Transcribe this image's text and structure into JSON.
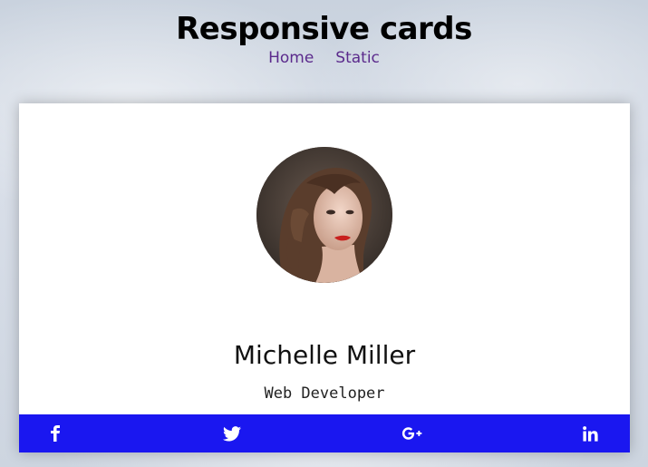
{
  "header": {
    "title": "Responsive cards",
    "nav": [
      {
        "label": "Home"
      },
      {
        "label": "Static"
      }
    ]
  },
  "card": {
    "name": "Michelle Miller",
    "role": "Web Developer",
    "social": [
      {
        "icon": "facebook-icon"
      },
      {
        "icon": "twitter-icon"
      },
      {
        "icon": "google-plus-icon"
      },
      {
        "icon": "linkedin-icon"
      }
    ]
  },
  "colors": {
    "social_bar": "#1a17f0",
    "nav_link": "#5b2a8c",
    "card_bg": "#ffffff"
  }
}
